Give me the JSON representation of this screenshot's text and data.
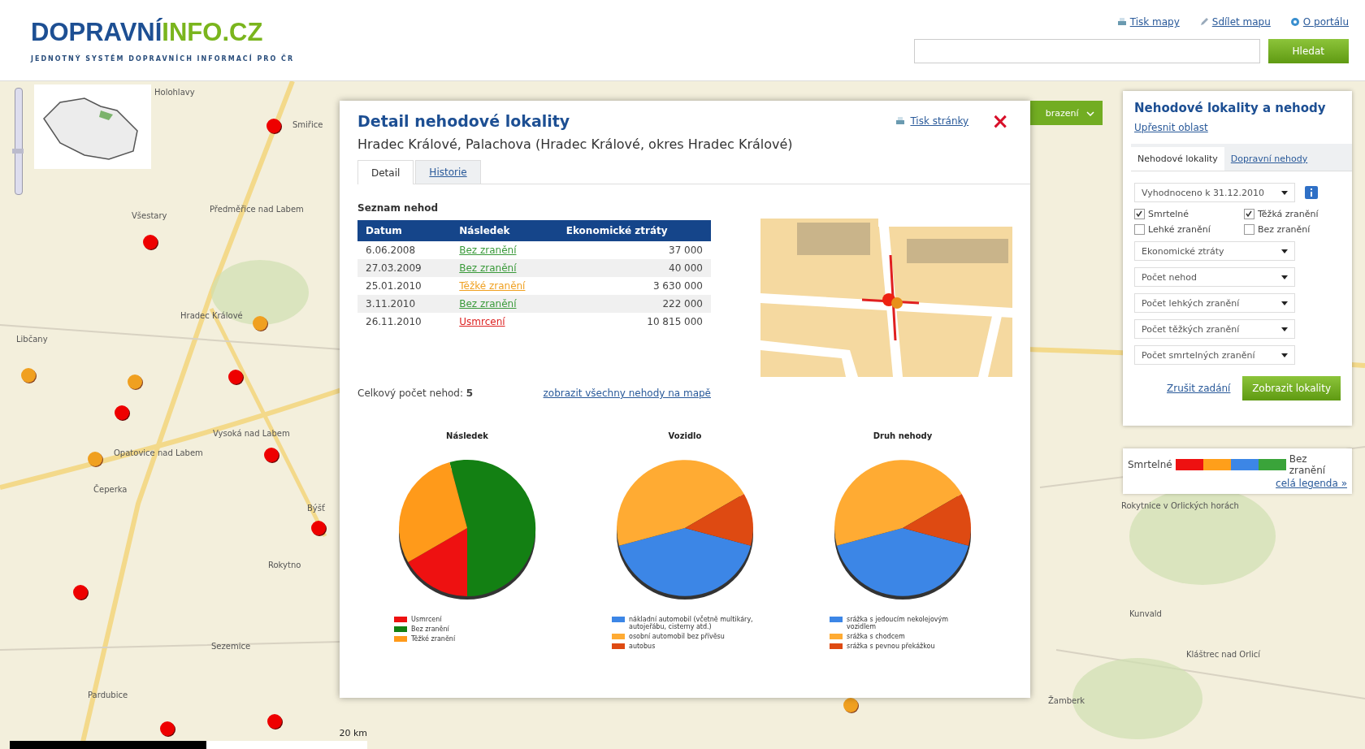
{
  "header": {
    "logo_primary": "DOPRAVNÍ",
    "logo_secondary": "INFO.CZ",
    "tagline": "JEDNOTNÝ SYSTÉM DOPRAVNÍCH INFORMACÍ PRO ČR",
    "links": [
      {
        "label": "Tisk mapy",
        "kind": "print"
      },
      {
        "label": "Sdílet mapu",
        "kind": "share"
      },
      {
        "label": "O portálu",
        "kind": "info"
      }
    ],
    "search_button": "Hledat"
  },
  "map": {
    "places": [
      {
        "label": "Holohlavy"
      },
      {
        "label": "Smiřice"
      },
      {
        "label": "Všestary"
      },
      {
        "label": "Předměřice nad Labem"
      },
      {
        "label": "Hradec Králové"
      },
      {
        "label": "Libčany"
      },
      {
        "label": "Opatovice nad Labem"
      },
      {
        "label": "Vysoká nad Labem"
      },
      {
        "label": "Čeperka"
      },
      {
        "label": "Býšť"
      },
      {
        "label": "Rokytno"
      },
      {
        "label": "Sezemice"
      },
      {
        "label": "Pardubice"
      },
      {
        "label": "Rokytnice v Orlických horách"
      },
      {
        "label": "Kunvald"
      },
      {
        "label": "Kláštrec nad Orlicí"
      },
      {
        "label": "Žamberk"
      }
    ],
    "scale": "20 km",
    "layer_button": "brazení",
    "zoom": {
      "level": 0.4
    }
  },
  "detail": {
    "title": "Detail nehodové lokality",
    "subtitle": "Hradec Králové, Palachova (Hradec Králové, okres Hradec Králové)",
    "print_link": "Tisk stránky",
    "close": "×",
    "tabs": [
      {
        "label": "Detail",
        "selected": true
      },
      {
        "label": "Historie",
        "selected": false
      }
    ],
    "list_title": "Seznam nehod",
    "table": {
      "columns": [
        "Datum",
        "Následek",
        "Ekonomické ztráty"
      ],
      "rows": [
        {
          "date": "6.06.2008",
          "outcome": "Bez zranění",
          "kind": "none",
          "loss": "37 000"
        },
        {
          "date": "27.03.2009",
          "outcome": "Bez zranění",
          "kind": "none",
          "loss": "40 000"
        },
        {
          "date": "25.01.2010",
          "outcome": "Těžké zranění",
          "kind": "severe",
          "loss": "3 630 000"
        },
        {
          "date": "3.11.2010",
          "outcome": "Bez zranění",
          "kind": "none",
          "loss": "222 000"
        },
        {
          "date": "26.11.2010",
          "outcome": "Usmrcení",
          "kind": "fatal",
          "loss": "10 815 000"
        }
      ]
    },
    "total": "Celkový počet nehod: **5**",
    "show_all_link": "zobrazit všechny nehody na mapě",
    "pies": [
      {
        "title": "Následek",
        "legend": [
          {
            "label": "Usmrcení",
            "color": "#ee1111"
          },
          {
            "label": "Bez zranění",
            "color": "#138013"
          },
          {
            "label": "Těžké zranění",
            "color": "#ff9a1a"
          }
        ]
      },
      {
        "title": "Vozidlo",
        "legend": [
          {
            "label": "nákladní automobil (včetně multikáry, autojeřábu, cisterny atd.)",
            "color": "#3c86e6"
          },
          {
            "label": "osobní automobil bez přívěsu",
            "color": "#ffab33"
          },
          {
            "label": "autobus",
            "color": "#de4a12"
          }
        ]
      },
      {
        "title": "Druh nehody",
        "legend": [
          {
            "label": "srážka s jedoucím nekolejovým vozidlem",
            "color": "#3c86e6"
          },
          {
            "label": "srážka s chodcem",
            "color": "#ffab33"
          },
          {
            "label": "srážka s pevnou překážkou",
            "color": "#de4a12"
          }
        ]
      }
    ]
  },
  "panel": {
    "title": "Nehodové lokality a nehody",
    "refine_link": "Upřesnit oblast",
    "tabs": [
      {
        "label": "Nehodové lokality",
        "selected": true
      },
      {
        "label": "Dopravní nehody",
        "selected": false
      }
    ],
    "period": "Vyhodnoceno k 31.12.2010",
    "checks": [
      {
        "label": "Smrtelné",
        "checked": true
      },
      {
        "label": "Těžká zranění",
        "checked": true
      },
      {
        "label": "Lehké zranění",
        "checked": false
      },
      {
        "label": "Bez zranění",
        "checked": false
      }
    ],
    "selects": [
      "Ekonomické ztráty",
      "Počet nehod",
      "Počet lehkých zranění",
      "Počet těžkých zranění",
      "Počet smrtelných zranění"
    ],
    "cancel_link": "Zrušit zadání",
    "submit": "Zobrazit lokality"
  },
  "legend": {
    "start": "Smrtelné",
    "end": "Bez zranění",
    "colors": [
      {
        "color": "#ee1111"
      },
      {
        "color": "#ff9f1a"
      },
      {
        "color": "#3c86e6"
      },
      {
        "color": "#3aa43a"
      }
    ],
    "link": "celá legenda »"
  }
}
